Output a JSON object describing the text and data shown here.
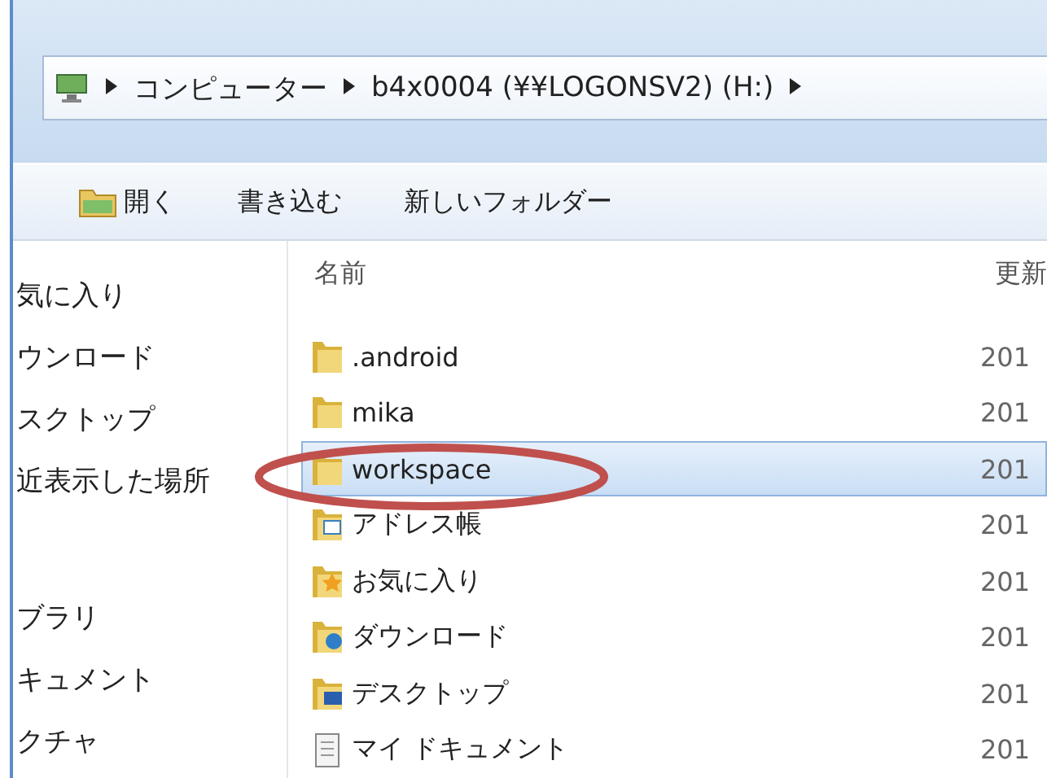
{
  "address_bar": {
    "crumbs": [
      "コンピューター",
      "b4x0004 (¥¥LOGONSV2) (H:)"
    ]
  },
  "toolbar": {
    "buttons": [
      {
        "label": "開く",
        "icon": true
      },
      {
        "label": "書き込む",
        "icon": false
      },
      {
        "label": "新しいフォルダー",
        "icon": false
      }
    ]
  },
  "sidebar": {
    "items": [
      {
        "label": "気に入り",
        "gap_before": false
      },
      {
        "label": "ウンロード",
        "gap_before": false
      },
      {
        "label": "スクトップ",
        "gap_before": false
      },
      {
        "label": "近表示した場所",
        "gap_before": false
      },
      {
        "label": "ブラリ",
        "gap_before": true
      },
      {
        "label": "キュメント",
        "gap_before": false
      },
      {
        "label": "クチャ",
        "gap_before": false
      }
    ]
  },
  "file_list": {
    "columns": [
      "名前",
      "更新"
    ],
    "rows": [
      {
        "name": ".android",
        "column_2": "201",
        "kind": "folder",
        "selected": false
      },
      {
        "name": "mika",
        "column_2": "201",
        "kind": "folder",
        "selected": false
      },
      {
        "name": "workspace",
        "column_2": "201",
        "kind": "folder",
        "selected": true
      },
      {
        "name": "アドレス帳",
        "column_2": "201",
        "kind": "contacts",
        "selected": false
      },
      {
        "name": "お気に入り",
        "column_2": "201",
        "kind": "favorites",
        "selected": false
      },
      {
        "name": "ダウンロード",
        "column_2": "201",
        "kind": "downloads",
        "selected": false
      },
      {
        "name": "デスクトップ",
        "column_2": "201",
        "kind": "desktop",
        "selected": false
      },
      {
        "name": "マイ ドキュメント",
        "column_2": "201",
        "kind": "documents",
        "selected": false
      }
    ]
  },
  "annotation": {
    "kind": "ellipse"
  }
}
